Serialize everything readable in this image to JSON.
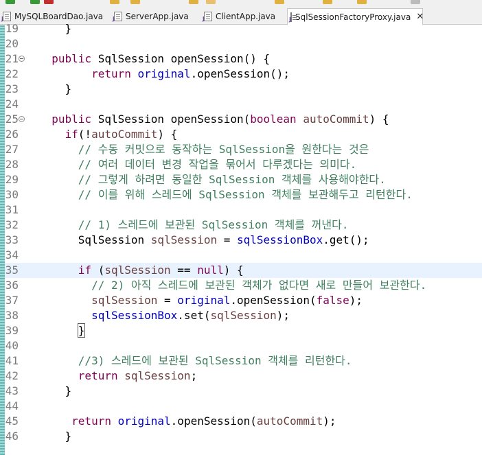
{
  "tabs": [
    {
      "label": "MySQLBoardDao.java",
      "active": false
    },
    {
      "label": "ServerApp.java",
      "active": false
    },
    {
      "label": "ClientApp.java",
      "active": false
    },
    {
      "label": "SqlSessionFactoryProxy.java",
      "active": true
    }
  ],
  "editor": {
    "current_line": "35",
    "lines": [
      {
        "n": "19",
        "fold": false,
        "seg": [
          {
            "t": "    }",
            "c": ""
          }
        ]
      },
      {
        "n": "20",
        "fold": false,
        "seg": []
      },
      {
        "n": "21",
        "fold": true,
        "seg": [
          {
            "t": "  public",
            "c": "kw"
          },
          {
            "t": " SqlSession openSession() {",
            "c": ""
          }
        ]
      },
      {
        "n": "22",
        "fold": false,
        "seg": [
          {
            "t": "        return",
            "c": "kw"
          },
          {
            "t": " ",
            "c": ""
          },
          {
            "t": "original",
            "c": "fld"
          },
          {
            "t": ".openSession();",
            "c": ""
          }
        ]
      },
      {
        "n": "23",
        "fold": false,
        "seg": [
          {
            "t": "    }",
            "c": ""
          }
        ]
      },
      {
        "n": "24",
        "fold": false,
        "seg": []
      },
      {
        "n": "25",
        "fold": true,
        "seg": [
          {
            "t": "  public",
            "c": "kw"
          },
          {
            "t": " SqlSession openSession(",
            "c": ""
          },
          {
            "t": "boolean",
            "c": "kw"
          },
          {
            "t": " ",
            "c": ""
          },
          {
            "t": "autoCommit",
            "c": "var"
          },
          {
            "t": ") {",
            "c": ""
          }
        ]
      },
      {
        "n": "26",
        "fold": false,
        "seg": [
          {
            "t": "    if",
            "c": "kw"
          },
          {
            "t": "(!",
            "c": ""
          },
          {
            "t": "autoCommit",
            "c": "var"
          },
          {
            "t": ") {",
            "c": ""
          }
        ]
      },
      {
        "n": "27",
        "fold": false,
        "seg": [
          {
            "t": "      // 수동 커밋으로 동작하는 SqlSession을 원한다는 것은",
            "c": "cm"
          }
        ]
      },
      {
        "n": "28",
        "fold": false,
        "seg": [
          {
            "t": "      // 여러 데이터 변경 작업을 묶어서 다루겠다는 의미다.",
            "c": "cm"
          }
        ]
      },
      {
        "n": "29",
        "fold": false,
        "seg": [
          {
            "t": "      // 그렇게 하려면 동일한 SqlSession 객체를 사용해야한다.",
            "c": "cm"
          }
        ]
      },
      {
        "n": "30",
        "fold": false,
        "seg": [
          {
            "t": "      // 이를 위해 스레드에 SqlSession 객체를 보관해두고 리턴한다.",
            "c": "cm"
          }
        ]
      },
      {
        "n": "31",
        "fold": false,
        "seg": []
      },
      {
        "n": "32",
        "fold": false,
        "seg": [
          {
            "t": "      // 1) 스레드에 보관된 SqlSession 객체를 꺼낸다.",
            "c": "cm"
          }
        ]
      },
      {
        "n": "33",
        "fold": false,
        "seg": [
          {
            "t": "      SqlSession ",
            "c": ""
          },
          {
            "t": "sqlSession",
            "c": "var"
          },
          {
            "t": " = ",
            "c": ""
          },
          {
            "t": "sqlSessionBox",
            "c": "fld"
          },
          {
            "t": ".get();",
            "c": ""
          }
        ]
      },
      {
        "n": "34",
        "fold": false,
        "seg": []
      },
      {
        "n": "35",
        "fold": false,
        "seg": [
          {
            "t": "      if",
            "c": "kw"
          },
          {
            "t": " (",
            "c": ""
          },
          {
            "t": "sqlSession",
            "c": "var"
          },
          {
            "t": " == ",
            "c": ""
          },
          {
            "t": "null",
            "c": "kw"
          },
          {
            "t": ") {",
            "c": ""
          }
        ]
      },
      {
        "n": "36",
        "fold": false,
        "seg": [
          {
            "t": "        // 2) 아직 스레드에 보관된 객체가 없다면 새로 만들어 보관한다.",
            "c": "cm"
          }
        ]
      },
      {
        "n": "37",
        "fold": false,
        "seg": [
          {
            "t": "        sqlSession",
            "c": "var"
          },
          {
            "t": " = ",
            "c": ""
          },
          {
            "t": "original",
            "c": "fld"
          },
          {
            "t": ".openSession(",
            "c": ""
          },
          {
            "t": "false",
            "c": "kw"
          },
          {
            "t": ");",
            "c": ""
          }
        ]
      },
      {
        "n": "38",
        "fold": false,
        "seg": [
          {
            "t": "        sqlSessionBox",
            "c": "fld"
          },
          {
            "t": ".set(",
            "c": ""
          },
          {
            "t": "sqlSession",
            "c": "var"
          },
          {
            "t": ");",
            "c": ""
          }
        ]
      },
      {
        "n": "39",
        "fold": false,
        "seg": [
          {
            "t": "      ",
            "c": ""
          },
          {
            "t": "}",
            "c": "bracket-box"
          }
        ]
      },
      {
        "n": "40",
        "fold": false,
        "seg": []
      },
      {
        "n": "41",
        "fold": false,
        "seg": [
          {
            "t": "      //3) 스레드에 보관된 SqlSession 객체를 리턴한다.",
            "c": "cm"
          }
        ]
      },
      {
        "n": "42",
        "fold": false,
        "seg": [
          {
            "t": "      return",
            "c": "kw"
          },
          {
            "t": " ",
            "c": ""
          },
          {
            "t": "sqlSession",
            "c": "var"
          },
          {
            "t": ";",
            "c": ""
          }
        ]
      },
      {
        "n": "43",
        "fold": false,
        "seg": [
          {
            "t": "    }",
            "c": ""
          }
        ]
      },
      {
        "n": "44",
        "fold": false,
        "seg": []
      },
      {
        "n": "45",
        "fold": false,
        "seg": [
          {
            "t": "     return",
            "c": "kw"
          },
          {
            "t": " ",
            "c": ""
          },
          {
            "t": "original",
            "c": "fld"
          },
          {
            "t": ".openSession(",
            "c": ""
          },
          {
            "t": "autoCommit",
            "c": "var"
          },
          {
            "t": ");",
            "c": ""
          }
        ]
      },
      {
        "n": "46",
        "fold": false,
        "seg": [
          {
            "t": "    }",
            "c": ""
          }
        ]
      }
    ]
  }
}
